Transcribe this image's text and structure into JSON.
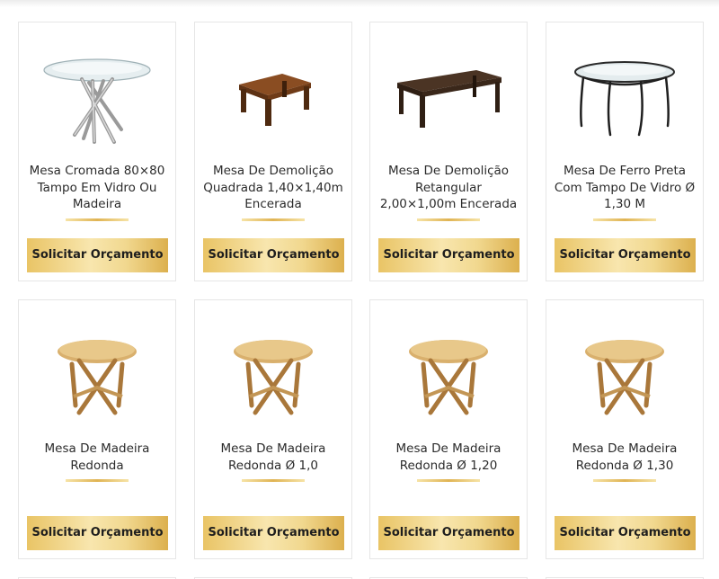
{
  "products": [
    {
      "title": "Mesa Cromada 80×80 Tampo Em Vidro Ou Madeira",
      "button": "Solicitar Orçamento",
      "image_icon": "chrome-glass-table-icon"
    },
    {
      "title": "Mesa De Demolição Quadrada 1,40×1,40m Encerada",
      "button": "Solicitar Orçamento",
      "image_icon": "square-wood-table-icon"
    },
    {
      "title": "Mesa De Demolição Retangular 2,00×1,00m Encerada",
      "button": "Solicitar Orçamento",
      "image_icon": "rect-wood-table-icon"
    },
    {
      "title": "Mesa De Ferro Preta Com Tampo De Vidro Ø 1,30 M",
      "button": "Solicitar Orçamento",
      "image_icon": "iron-glass-table-icon"
    },
    {
      "title": "Mesa De Madeira Redonda",
      "button": "Solicitar Orçamento",
      "image_icon": "round-folding-table-icon"
    },
    {
      "title": "Mesa De Madeira Redonda Ø 1,0",
      "button": "Solicitar Orçamento",
      "image_icon": "round-folding-table-icon"
    },
    {
      "title": "Mesa De Madeira Redonda Ø 1,20",
      "button": "Solicitar Orçamento",
      "image_icon": "round-folding-table-icon"
    },
    {
      "title": "Mesa De Madeira Redonda Ø 1,30",
      "button": "Solicitar Orçamento",
      "image_icon": "round-folding-table-icon"
    }
  ],
  "colors": {
    "button_gold": "#e9c465",
    "underline_gold": "#e0b454",
    "text": "#2b2b2b"
  }
}
